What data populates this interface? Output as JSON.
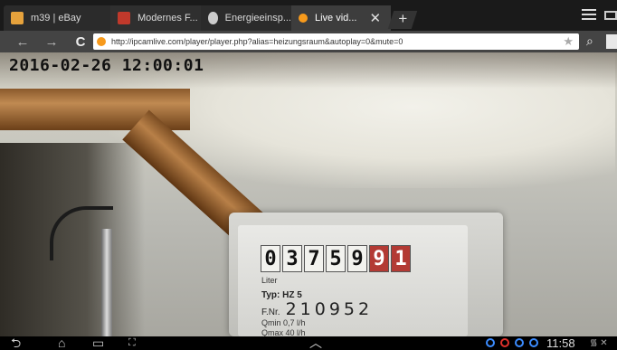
{
  "browser": {
    "tabs": [
      {
        "label": "m39 | eBay",
        "favicon_color": "#e6a23c"
      },
      {
        "label": "Modernes F...",
        "favicon_color": "#c0392b"
      },
      {
        "label": "Energieeinsp...",
        "favicon_color": "#cccccc"
      },
      {
        "label": "Live vid...",
        "favicon_color": "#f79a1c",
        "active": true
      }
    ],
    "new_tab_label": "+",
    "url": "http://ipcamlive.com/player/player.php?alias=heizungsraum&autoplay=0&mute=0",
    "back_label": "←",
    "forward_label": "→",
    "reload_label": "C"
  },
  "video": {
    "timestamp": "2016-02-26  12:00:01",
    "meter": {
      "counter_digits": [
        "0",
        "3",
        "7",
        "5",
        "9",
        "9",
        "1"
      ],
      "red_digit_count": 2,
      "unit_label": "Liter",
      "type_label": "Typ: HZ 5",
      "fnr_label": "F.Nr.",
      "fnr_value": "210952",
      "qmin": "Qmin 0,7 l/h",
      "qmax": "Qmax 40 l/h"
    }
  },
  "system_bar": {
    "clock": "11:58",
    "nav_back": "⮌",
    "nav_home": "⌂",
    "nav_recent": "▭",
    "nav_screenshot": "⛶",
    "nav_up": "︿"
  }
}
